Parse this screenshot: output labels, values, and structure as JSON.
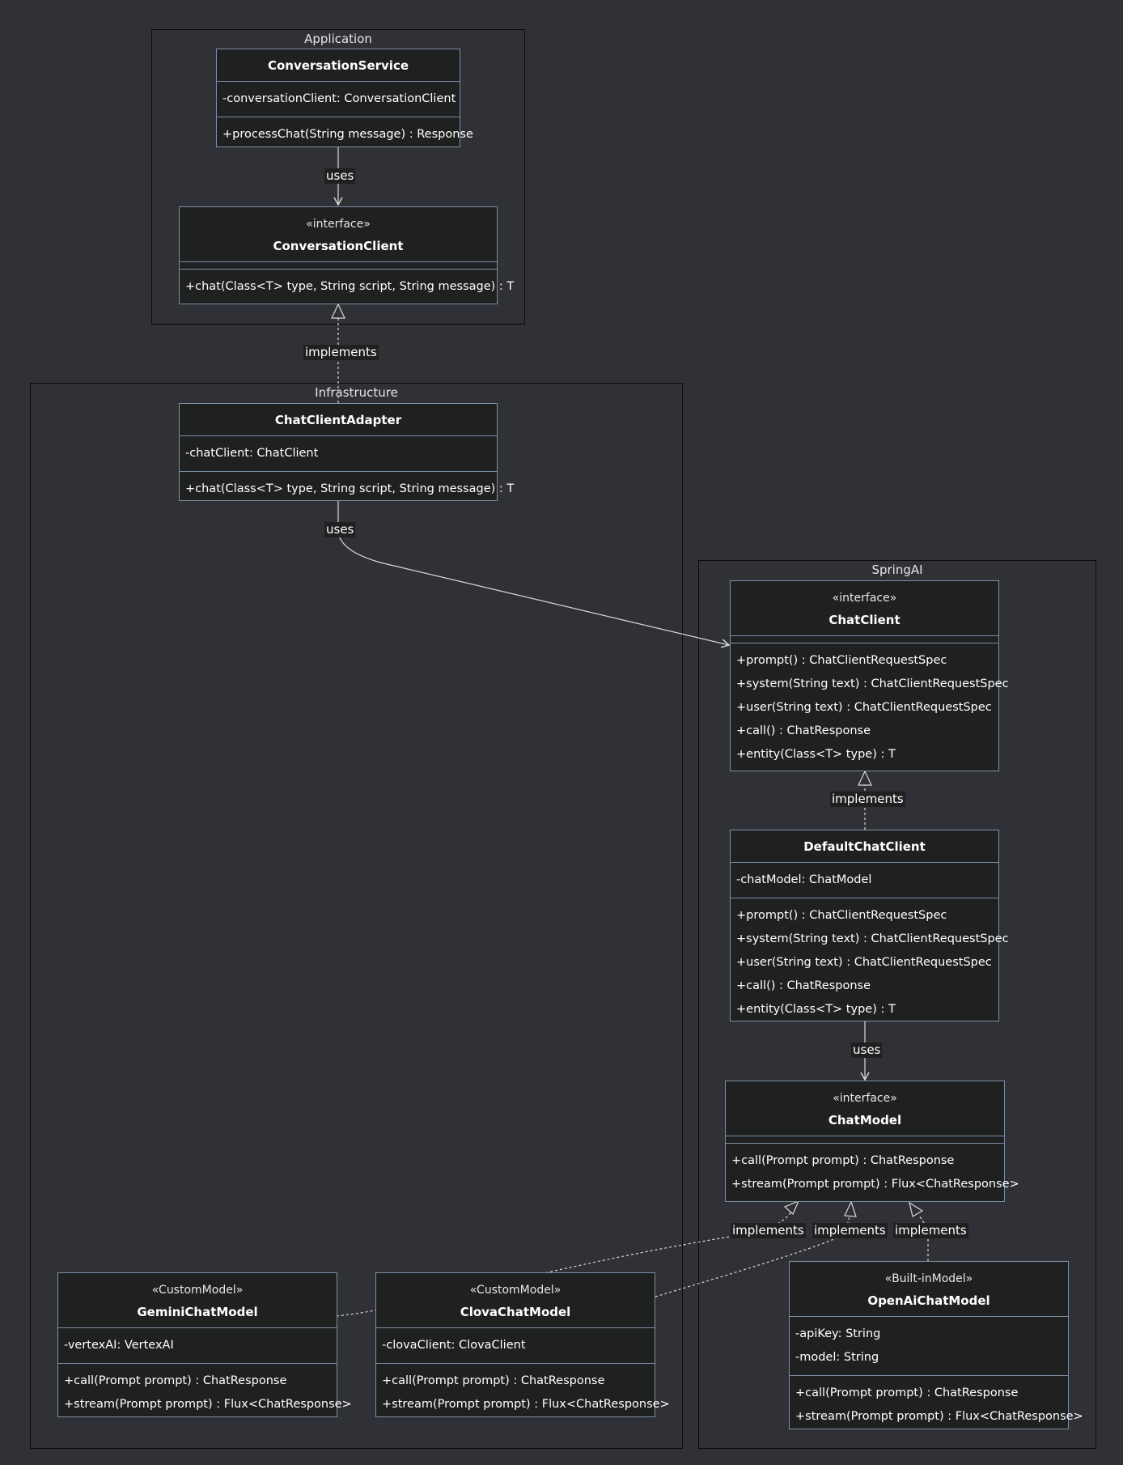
{
  "groups": {
    "application": "Application",
    "infrastructure": "Infrastructure",
    "springai": "SpringAI"
  },
  "classes": {
    "conversation_service": {
      "name": "ConversationService",
      "attributes": [
        "-conversationClient: ConversationClient"
      ],
      "methods": [
        "+processChat(String message) : Response"
      ]
    },
    "conversation_client": {
      "stereotype": "«interface»",
      "name": "ConversationClient",
      "methods": [
        "+chat(Class<T> type, String script, String message) : T"
      ]
    },
    "chat_client_adapter": {
      "name": "ChatClientAdapter",
      "attributes": [
        "-chatClient: ChatClient"
      ],
      "methods": [
        "+chat(Class<T> type, String script, String message) : T"
      ]
    },
    "chat_client": {
      "stereotype": "«interface»",
      "name": "ChatClient",
      "methods": [
        "+prompt() : ChatClientRequestSpec",
        "+system(String text) : ChatClientRequestSpec",
        "+user(String text) : ChatClientRequestSpec",
        "+call() : ChatResponse",
        "+entity(Class<T> type) : T"
      ]
    },
    "default_chat_client": {
      "name": "DefaultChatClient",
      "attributes": [
        "-chatModel: ChatModel"
      ],
      "methods": [
        "+prompt() : ChatClientRequestSpec",
        "+system(String text) : ChatClientRequestSpec",
        "+user(String text) : ChatClientRequestSpec",
        "+call() : ChatResponse",
        "+entity(Class<T> type) : T"
      ]
    },
    "chat_model": {
      "stereotype": "«interface»",
      "name": "ChatModel",
      "methods": [
        "+call(Prompt prompt) : ChatResponse",
        "+stream(Prompt prompt) : Flux<ChatResponse>"
      ]
    },
    "gemini_chat_model": {
      "stereotype": "«CustomModel»",
      "name": "GeminiChatModel",
      "attributes": [
        "-vertexAI: VertexAI"
      ],
      "methods": [
        "+call(Prompt prompt) : ChatResponse",
        "+stream(Prompt prompt) : Flux<ChatResponse>"
      ]
    },
    "clova_chat_model": {
      "stereotype": "«CustomModel»",
      "name": "ClovaChatModel",
      "attributes": [
        "-clovaClient: ClovaClient"
      ],
      "methods": [
        "+call(Prompt prompt) : ChatResponse",
        "+stream(Prompt prompt) : Flux<ChatResponse>"
      ]
    },
    "openai_chat_model": {
      "stereotype": "«Built-inModel»",
      "name": "OpenAiChatModel",
      "attributes": [
        "-apiKey: String",
        "-model: String"
      ],
      "methods": [
        "+call(Prompt prompt) : ChatResponse",
        "+stream(Prompt prompt) : Flux<ChatResponse>"
      ]
    }
  },
  "edge_labels": {
    "service_uses_client": "uses",
    "adapter_implements_client": "implements",
    "adapter_uses_chatclient": "uses",
    "default_implements_chatclient": "implements",
    "default_uses_chatmodel": "uses",
    "gemini_implements_chatmodel": "implements",
    "clova_implements_chatmodel": "implements",
    "openai_implements_chatmodel": "implements"
  },
  "colors": {
    "background": "#303136",
    "node_fill": "#1f2020",
    "node_border": "#7c8fa3",
    "edge": "#d9d9d9"
  }
}
